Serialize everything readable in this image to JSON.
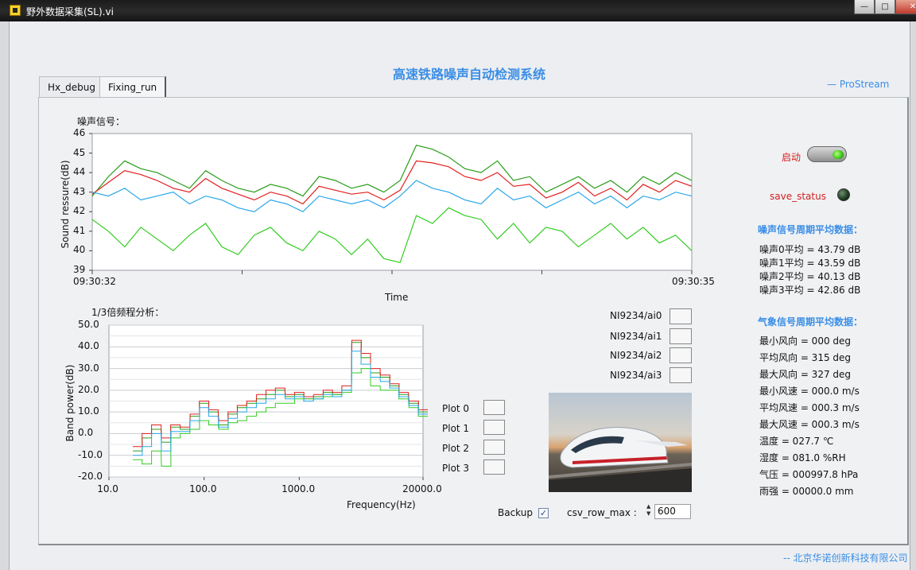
{
  "window": {
    "title": "野外数据采集(SL).vi",
    "min_label": "—",
    "max_label": "□",
    "close_label": "✕",
    "app_icon": "labview-vi-icon"
  },
  "header": {
    "title": "高速铁路噪声自动检测系统",
    "brand": "— ProStream"
  },
  "tabs": [
    {
      "label": "Hx_debug",
      "active": false
    },
    {
      "label": "Fixing_run",
      "active": true
    }
  ],
  "controls": {
    "start_label": "启动",
    "start_on": true,
    "save_status_label": "save_status",
    "save_status_on": false,
    "backup_label": "Backup",
    "backup_checked": true,
    "csv_row_max_label": "csv_row_max :",
    "csv_row_max_value": "600"
  },
  "noise_stats": {
    "title": "噪声信号周期平均数据：",
    "items": [
      "噪声0平均 = 43.79 dB",
      "噪声1平均 = 43.59 dB",
      "噪声2平均 = 40.13 dB",
      "噪声3平均 = 42.86 dB"
    ]
  },
  "weather_stats": {
    "title": "气象信号周期平均数据：",
    "items": [
      "最小风向 = 000 deg",
      "平均风向 = 315 deg",
      "最大风向 = 327 deg",
      "最小风速 = 000.0 m/s",
      "平均风速 = 000.3 m/s",
      "最大风速 = 000.3 m/s",
      "温度 = 027.7 ℃",
      "湿度 = 081.0 %RH",
      "气压 = 000997.8 hPa",
      "雨强 = 00000.0 mm"
    ]
  },
  "company": "-- 北京华诺创新科技有限公司",
  "colors": {
    "ai0": "#2a9d1a",
    "ai1": "#e02020",
    "ai2": "#33cc22",
    "ai3": "#2aa7e8",
    "accent": "#3a8ee6"
  },
  "chart_data": [
    {
      "type": "line",
      "title": "噪声信号：",
      "xlabel": "Time",
      "ylabel": "Sound ressure(dB)",
      "x_ticks": [
        "09:30:32",
        "09:30:35"
      ],
      "y_ticks": [
        "46",
        "45",
        "44",
        "43",
        "42",
        "41",
        "40",
        "39"
      ],
      "ylim": [
        39,
        46
      ],
      "grid": false,
      "legend_position": "bottom-right",
      "series": [
        {
          "name": "NI9234/ai0",
          "values": [
            42.8,
            43.8,
            44.6,
            44.2,
            44.0,
            43.6,
            43.2,
            44.1,
            43.6,
            43.2,
            43.0,
            43.4,
            43.2,
            42.8,
            43.8,
            43.6,
            43.2,
            43.4,
            43.0,
            43.6,
            45.4,
            45.2,
            44.8,
            44.2,
            44.0,
            44.6,
            43.6,
            43.8,
            43.0,
            43.4,
            43.8,
            43.2,
            43.6,
            43.0,
            43.8,
            43.4,
            44.0,
            43.6
          ]
        },
        {
          "name": "NI9234/ai1",
          "values": [
            42.9,
            43.5,
            44.1,
            43.9,
            43.6,
            43.2,
            43.0,
            43.7,
            43.2,
            42.9,
            42.6,
            43.0,
            42.8,
            42.4,
            43.3,
            43.1,
            42.9,
            43.0,
            42.6,
            43.1,
            44.6,
            44.5,
            44.3,
            43.8,
            43.6,
            44.0,
            43.3,
            43.4,
            42.7,
            43.0,
            43.5,
            42.8,
            43.2,
            42.6,
            43.4,
            43.0,
            43.6,
            43.3
          ]
        },
        {
          "name": "NI9234/ai2",
          "values": [
            41.6,
            41.0,
            40.2,
            41.2,
            40.6,
            40.0,
            40.8,
            41.4,
            40.2,
            39.8,
            40.8,
            41.2,
            40.4,
            40.0,
            41.0,
            40.6,
            39.8,
            40.6,
            39.6,
            39.4,
            41.8,
            41.4,
            42.2,
            41.8,
            41.6,
            40.6,
            41.4,
            40.4,
            41.2,
            41.0,
            40.2,
            40.8,
            41.4,
            40.6,
            41.2,
            40.4,
            40.8,
            40.0
          ]
        },
        {
          "name": "NI9234/ai3",
          "values": [
            43.0,
            42.8,
            43.2,
            42.6,
            42.8,
            43.0,
            42.4,
            42.8,
            42.6,
            42.2,
            42.0,
            42.6,
            42.4,
            42.0,
            42.8,
            42.6,
            42.4,
            42.6,
            42.2,
            42.8,
            43.6,
            43.2,
            43.0,
            42.6,
            42.4,
            43.2,
            42.6,
            42.8,
            42.2,
            42.6,
            43.0,
            42.4,
            42.8,
            42.2,
            42.8,
            42.6,
            43.0,
            42.8
          ]
        }
      ]
    },
    {
      "type": "line",
      "title": "1/3倍频程分析：",
      "xlabel": "Frequency(Hz)",
      "ylabel": "Band power(dB)",
      "x_scale": "log",
      "x_ticks": [
        "10.0",
        "100.0",
        "1000.0",
        "20000.0"
      ],
      "y_ticks": [
        "50.0",
        "40.0",
        "30.0",
        "20.0",
        "10.0",
        "0.0",
        "-10.0",
        "-20.0"
      ],
      "ylim": [
        -20,
        50
      ],
      "xlim": [
        10,
        20000
      ],
      "grid": true,
      "legend_position": "right",
      "freqs": [
        20,
        25,
        31.5,
        40,
        50,
        63,
        80,
        100,
        125,
        160,
        200,
        250,
        315,
        400,
        500,
        630,
        800,
        1000,
        1250,
        1600,
        2000,
        2500,
        3150,
        4000,
        5000,
        6300,
        8000,
        10000,
        12500,
        16000,
        20000
      ],
      "series": [
        {
          "name": "Plot 0",
          "values": [
            -8,
            -2,
            2,
            -4,
            3,
            2,
            8,
            14,
            10,
            4,
            9,
            12,
            14,
            16,
            18,
            20,
            17,
            18,
            16,
            17,
            19,
            18,
            20,
            42,
            35,
            28,
            26,
            22,
            18,
            14,
            10
          ]
        },
        {
          "name": "Plot 1",
          "values": [
            -6,
            0,
            4,
            -2,
            4,
            3,
            9,
            15,
            11,
            6,
            10,
            13,
            15,
            18,
            20,
            21,
            18,
            19,
            17,
            18,
            20,
            19,
            22,
            43,
            37,
            30,
            27,
            23,
            19,
            15,
            11
          ]
        },
        {
          "name": "Plot 2",
          "values": [
            -12,
            -14,
            -8,
            -15,
            -2,
            0,
            2,
            6,
            4,
            2,
            5,
            6,
            8,
            10,
            12,
            14,
            14,
            16,
            15,
            16,
            17,
            18,
            19,
            28,
            30,
            22,
            20,
            20,
            16,
            12,
            8
          ]
        },
        {
          "name": "Plot 3",
          "values": [
            -10,
            -6,
            0,
            -8,
            1,
            1,
            6,
            12,
            8,
            3,
            7,
            10,
            12,
            14,
            16,
            18,
            16,
            17,
            15,
            16,
            18,
            17,
            20,
            38,
            32,
            26,
            24,
            21,
            17,
            13,
            9
          ]
        }
      ]
    }
  ]
}
